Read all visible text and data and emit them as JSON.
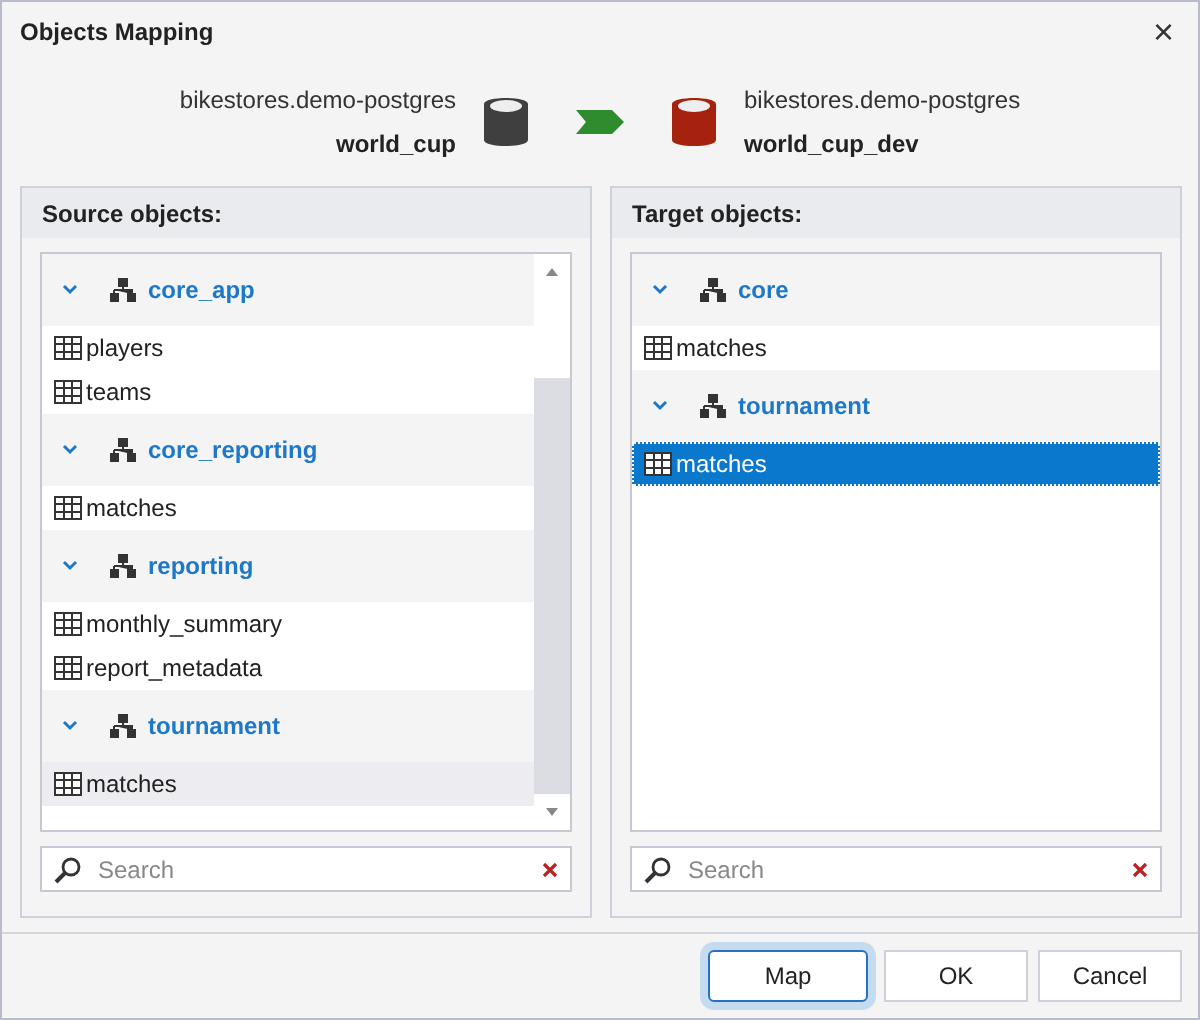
{
  "window": {
    "title": "Objects Mapping",
    "close": "×"
  },
  "source": {
    "server": "bikestores.demo-postgres",
    "database": "world_cup"
  },
  "target": {
    "server": "bikestores.demo-postgres",
    "database": "world_cup_dev"
  },
  "panels": [
    {
      "title": "Source objects:",
      "scrollbar": true,
      "focused": false,
      "search": {
        "placeholder": "Search"
      },
      "groups": [
        {
          "name": "core_app",
          "expanded": true,
          "children": [
            {
              "name": "players",
              "selected": false
            },
            {
              "name": "teams",
              "selected": false
            }
          ]
        },
        {
          "name": "core_reporting",
          "expanded": true,
          "children": [
            {
              "name": "matches",
              "selected": false
            }
          ]
        },
        {
          "name": "reporting",
          "expanded": true,
          "children": [
            {
              "name": "monthly_summary",
              "selected": false
            },
            {
              "name": "report_metadata",
              "selected": false
            }
          ]
        },
        {
          "name": "tournament",
          "expanded": true,
          "children": [
            {
              "name": "matches",
              "selected": true
            }
          ]
        }
      ]
    },
    {
      "title": "Target objects:",
      "scrollbar": false,
      "focused": true,
      "search": {
        "placeholder": "Search"
      },
      "groups": [
        {
          "name": "core",
          "expanded": true,
          "children": [
            {
              "name": "matches",
              "selected": false
            }
          ]
        },
        {
          "name": "tournament",
          "expanded": true,
          "children": [
            {
              "name": "matches",
              "selected": true
            }
          ]
        }
      ]
    }
  ],
  "buttons": [
    {
      "label": "Map",
      "default": true
    },
    {
      "label": "OK",
      "default": false
    },
    {
      "label": "Cancel",
      "default": false
    }
  ]
}
